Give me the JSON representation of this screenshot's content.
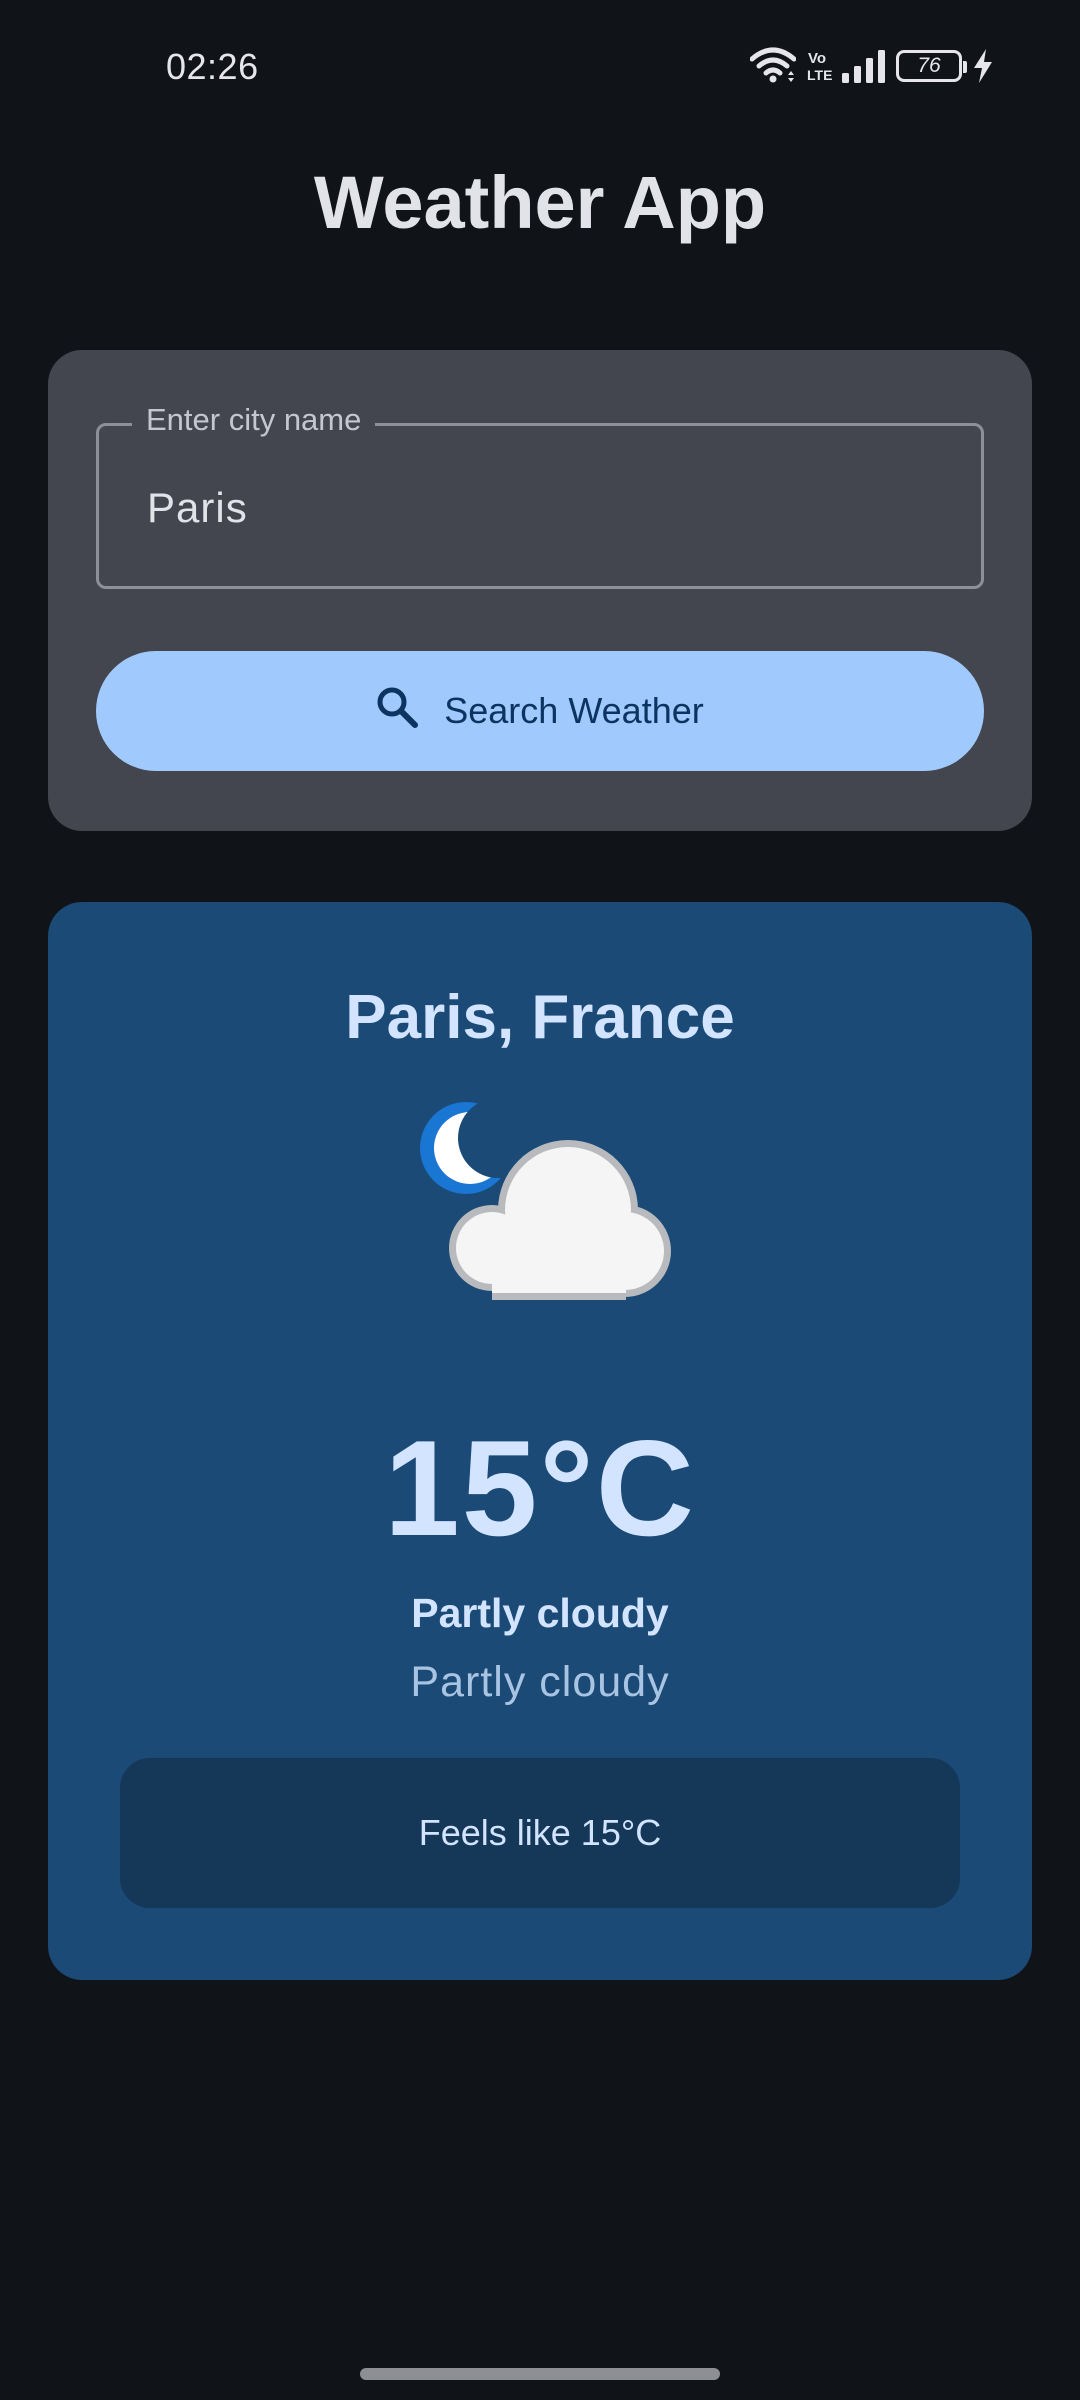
{
  "status_bar": {
    "time": "02:26",
    "battery_level": "76",
    "icons": [
      "wifi-icon",
      "volte-icon",
      "signal-icon",
      "battery-icon",
      "charging-icon"
    ]
  },
  "app": {
    "title": "Weather App"
  },
  "search": {
    "field_label": "Enter city name",
    "field_value": "Paris",
    "button_label": "Search Weather",
    "button_icon": "search-icon"
  },
  "weather": {
    "location": "Paris, France",
    "icon": "partly-cloudy-night-icon",
    "temperature": "15°C",
    "condition": "Partly cloudy",
    "description": "Partly cloudy",
    "feels_like": "Feels like 15°C"
  },
  "colors": {
    "background": "#101317",
    "search_card": "#43464e",
    "primary_button": "#a0cafd",
    "weather_card": "#1a4a75",
    "feels_like_box": "#153758"
  }
}
